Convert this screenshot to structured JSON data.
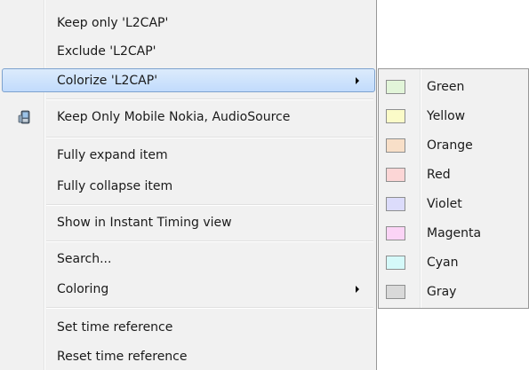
{
  "menu": {
    "keep_only": "Keep only 'L2CAP'",
    "exclude": "Exclude 'L2CAP'",
    "colorize": "Colorize 'L2CAP'",
    "keep_only_device": "Keep Only Mobile Nokia, AudioSource",
    "expand": "Fully expand item",
    "collapse": "Fully collapse item",
    "instant_timing": "Show in Instant Timing view",
    "search": "Search...",
    "coloring": "Coloring",
    "set_time_ref": "Set time reference",
    "reset_time_ref": "Reset time reference"
  },
  "colorize_submenu": {
    "items": [
      {
        "label": "Green",
        "color": "#e2f5d9"
      },
      {
        "label": "Yellow",
        "color": "#fbfbc8"
      },
      {
        "label": "Orange",
        "color": "#f8dfc8"
      },
      {
        "label": "Red",
        "color": "#fcd6d6"
      },
      {
        "label": "Violet",
        "color": "#dcdcfb"
      },
      {
        "label": "Magenta",
        "color": "#fbd4f6"
      },
      {
        "label": "Cyan",
        "color": "#d5f9f9"
      },
      {
        "label": "Gray",
        "color": "#d9d9d9"
      }
    ]
  },
  "icons": {
    "device_icon": "mobile-device-icon"
  },
  "colors": {
    "highlight_border": "#7da2ce",
    "menu_background": "#f1f1f1"
  }
}
